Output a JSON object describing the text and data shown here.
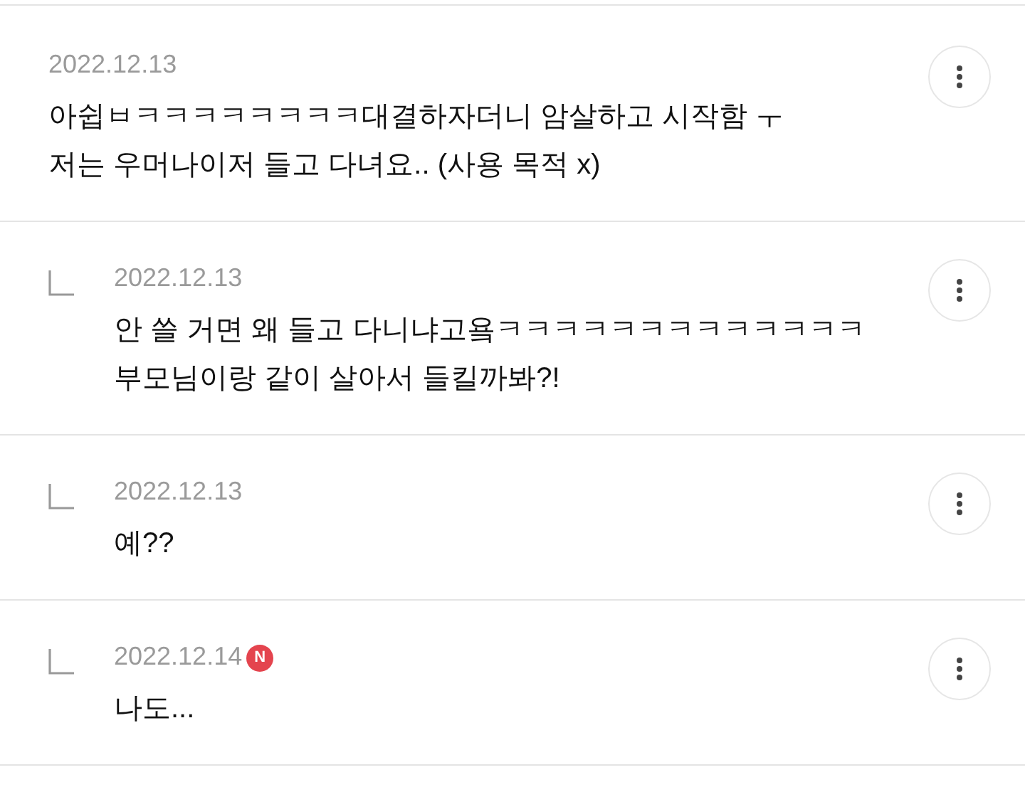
{
  "comments": [
    {
      "reply": false,
      "date": "2022.12.13",
      "lines": [
        "아쉽ㅂㅋㅋㅋㅋㅋㅋㅋㅋ대결하자더니 암살하고 시작함 ㅜ",
        "저는 우머나이저 들고 다녀요.. (사용 목적 x)"
      ]
    },
    {
      "reply": true,
      "date": "2022.12.13",
      "lines": [
        "안 쓸 거면 왜 들고 다니냐고욬ㅋㅋㅋㅋㅋㅋㅋㅋㅋㅋㅋㅋㅋ",
        "부모님이랑 같이 살아서 들킬까봐?!"
      ]
    },
    {
      "reply": true,
      "date": "2022.12.13",
      "lines": [
        "예??"
      ]
    },
    {
      "reply": true,
      "date": "2022.12.14",
      "new_badge": "N",
      "lines": [
        "나도..."
      ]
    }
  ]
}
